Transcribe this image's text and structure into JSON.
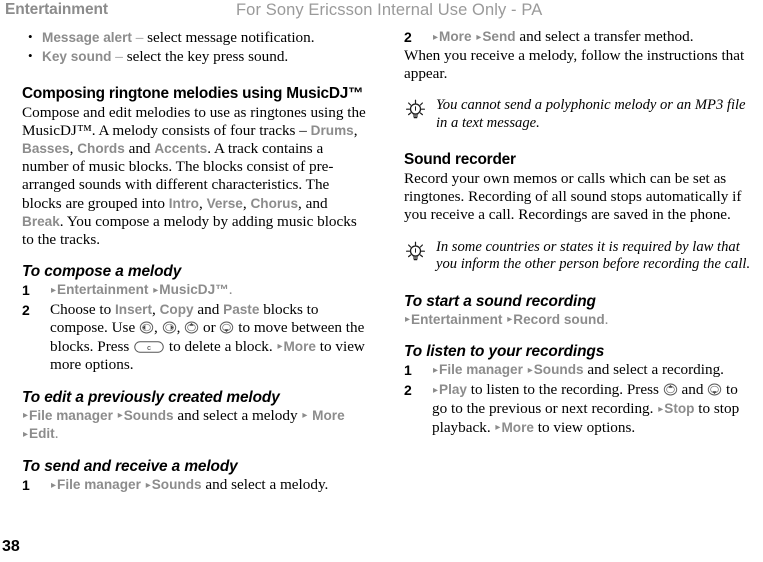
{
  "page": {
    "running_head": "Entertainment",
    "watermark": "For Sony Ericsson Internal Use Only - PA",
    "folio": "38",
    "ui_gray": "#8c8c8c",
    "body_black": "#000000"
  },
  "left_column": {
    "bullets": [
      {
        "term": "Message alert",
        "dash": " – ",
        "text": "select message notification."
      },
      {
        "term": "Key sound",
        "dash": " – ",
        "text": "select the key press sound."
      }
    ],
    "section": {
      "heading": "Composing ringtone melodies using MusicDJ™",
      "para_1": "Compose and edit melodies to use as ringtones using the MusicDJ™. A melody consists of four tracks – ",
      "track_1": "Drums",
      "sep_1": ", ",
      "track_2": "Basses",
      "sep_2": ", ",
      "track_3": "Chords",
      "sep_3": " and ",
      "track_4": "Accents",
      "para_2": ". A track contains a number of music blocks. The blocks consist of pre-arranged sounds with different characteristics. The blocks are grouped into ",
      "group_1": "Intro",
      "gsep_1": ", ",
      "group_2": "Verse",
      "gsep_2": ", ",
      "group_3": "Chorus",
      "gsep_3": ", and ",
      "group_4": "Break",
      "para_3": ". You compose a melody by adding music blocks to the tracks."
    },
    "task_compose": {
      "heading": "To compose a melody",
      "step_1": {
        "num": "1",
        "menu_1": "Entertainment",
        "menu_2": "MusicDJ™",
        "tail": "."
      },
      "step_2": {
        "num": "2",
        "a": "Choose to ",
        "ui_insert": "Insert",
        "b": ", ",
        "ui_copy": "Copy",
        "c": " and ",
        "ui_paste": "Paste",
        "d": " blocks to compose. Use ",
        "e": ", ",
        "f": ", ",
        "g": " or ",
        "h": " to move between the blocks. Press ",
        "i": " to delete a block. ",
        "ui_more": "More",
        "j": " to view more options."
      }
    },
    "task_edit": {
      "heading": "To edit a previously created melody",
      "menu_1": "File manager",
      "menu_2": "Sounds",
      "mid": " and select a melody ",
      "menu_3": "More",
      "menu_4": "Edit",
      "tail": "."
    },
    "task_send": {
      "heading": "To send and receive a melody",
      "step_1": {
        "num": "1",
        "menu_1": "File manager",
        "menu_2": "Sounds",
        "tail": " and select a melody."
      }
    }
  },
  "right_column": {
    "task_send_cont": {
      "step_2": {
        "num": "2",
        "menu_1": "More",
        "menu_2": "Send",
        "tail": " and select a transfer method."
      },
      "para": "When you receive a melody, follow the instructions that appear."
    },
    "tip_1": {
      "icon": "lightbulb-icon",
      "text": "You cannot send a polyphonic melody or an MP3 file in a text message."
    },
    "section": {
      "heading": "Sound recorder",
      "para": "Record your own memos or calls which can be set as ringtones. Recording of all sound stops automatically if you receive a call. Recordings are saved in the phone."
    },
    "tip_2": {
      "icon": "lightbulb-icon",
      "text": "In some countries or states it is required by law that you inform the other person before recording the call."
    },
    "task_start_recording": {
      "heading": "To start a sound recording",
      "menu_1": "Entertainment",
      "menu_2": "Record sound",
      "tail": "."
    },
    "task_listen": {
      "heading": "To listen to your recordings",
      "step_1": {
        "num": "1",
        "menu_1": "File manager",
        "menu_2": "Sounds",
        "tail": " and select a recording."
      },
      "step_2": {
        "num": "2",
        "ui_play": "Play",
        "a": " to listen to the recording. Press ",
        "b": " and ",
        "c": " to go to the previous or next recording. ",
        "ui_stop": "Stop",
        "d": " to stop playback. ",
        "ui_more": "More",
        "e": " to view options."
      }
    }
  },
  "glyphs": {
    "arrow": "▸",
    "nav_left": "nav-key-left-icon",
    "nav_right": "nav-key-right-icon",
    "nav_up": "nav-key-up-icon",
    "nav_down": "nav-key-down-icon",
    "clear_key": "clear-key-c-icon"
  }
}
